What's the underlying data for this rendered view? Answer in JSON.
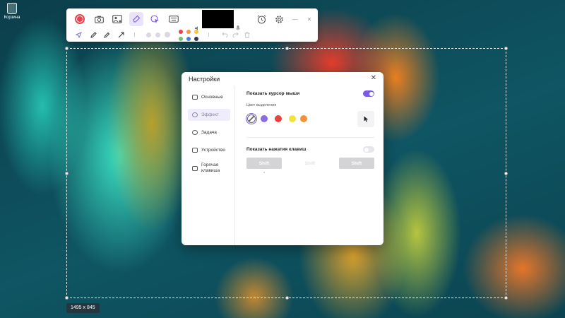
{
  "desktop": {
    "recycle_bin_label": "Корзина"
  },
  "toolbar": {
    "record_icon": "record-icon",
    "screenshot_icon": "camera-icon",
    "webcam_icon": "webcam-icon",
    "pen_mode_icon": "pen-mode-icon",
    "cursor_effect_icon": "cursor-click-icon",
    "keyboard_icon": "keyboard-icon",
    "timer_icon": "alarm-clock-icon",
    "settings_icon": "gear-icon",
    "minimize_label": "—",
    "close_label": "✕",
    "tools": [
      "pointer-icon",
      "pencil-icon",
      "marker-icon",
      "arrow-icon"
    ],
    "palette": [
      "#e9424d",
      "#f29a3a",
      "#f5c640",
      "#6fbf74",
      "#4a7fe0",
      "#2b3a50"
    ],
    "undo_icon": "undo-icon",
    "redo_icon": "redo-icon",
    "delete_icon": "trash-icon"
  },
  "selection": {
    "dimensions": "1495 x 845"
  },
  "dialog": {
    "title": "Настройки",
    "close": "✕",
    "sidebar": [
      {
        "label": "Основные",
        "icon": "toggle-icon",
        "active": false
      },
      {
        "label": "Эффект",
        "icon": "sparkle-icon",
        "active": true
      },
      {
        "label": "Задача",
        "icon": "clock-icon",
        "active": false
      },
      {
        "label": "Устройство",
        "icon": "device-icon",
        "active": false
      },
      {
        "label": "Горячая клавиша",
        "icon": "keyboard-icon",
        "active": false
      }
    ],
    "show_cursor": {
      "label": "Показать курсор мыши",
      "enabled": true
    },
    "highlight_color": {
      "label": "Цвет выделения",
      "options": [
        "none",
        "#8a6de6",
        "#e8433f",
        "#f5e13b",
        "#f2913a"
      ],
      "selected": "none"
    },
    "cursor_preview_icon": "mouse-cursor-icon",
    "show_keystrokes": {
      "label": "Показать нажатия клавиш",
      "enabled": false,
      "keys": [
        "Shift",
        "Shift",
        "Shift"
      ]
    }
  },
  "colors": {
    "accent": "#7c5ce0",
    "record": "#e9424d"
  }
}
